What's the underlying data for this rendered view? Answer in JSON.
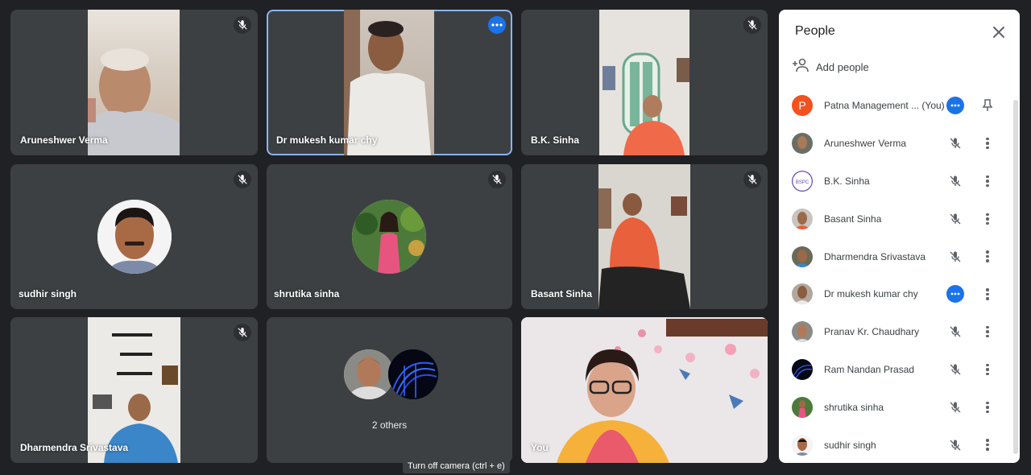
{
  "tiles": [
    {
      "name": "Aruneshwer Verma"
    },
    {
      "name": "Dr mukesh kumar chy"
    },
    {
      "name": "B.K. Sinha"
    },
    {
      "name": "sudhir singh"
    },
    {
      "name": "shrutika sinha"
    },
    {
      "name": "Basant Sinha"
    },
    {
      "name": "Dharmendra Srivastava"
    },
    {
      "name": "2 others"
    },
    {
      "name": "You"
    }
  ],
  "tooltip": "Turn off camera (ctrl + e)",
  "panel": {
    "title": "People",
    "add_people": "Add people",
    "participants": [
      {
        "name": "Patna Management ...",
        "suffix": "(You)",
        "initial": "P",
        "avatar_color": "#f4511e"
      },
      {
        "name": "Aruneshwer Verma"
      },
      {
        "name": "B.K. Sinha",
        "badge": "BSPC"
      },
      {
        "name": "Basant Sinha"
      },
      {
        "name": "Dharmendra Srivastava"
      },
      {
        "name": "Dr mukesh kumar chy"
      },
      {
        "name": "Pranav Kr. Chaudhary"
      },
      {
        "name": "Ram Nandan Prasad"
      },
      {
        "name": "shrutika sinha"
      },
      {
        "name": "sudhir singh"
      }
    ]
  },
  "colors": {
    "background": "#202124",
    "tile": "#3c4043",
    "accent": "#1a73e8",
    "active_border": "#8ab4f8"
  }
}
